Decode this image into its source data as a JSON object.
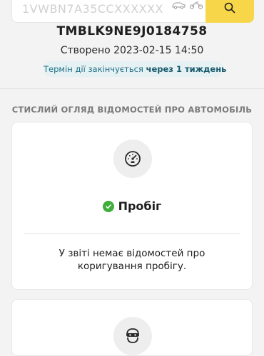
{
  "search": {
    "value": "1VWBN7A35CCXXXXXX",
    "icons": [
      "car-icon",
      "motorcycle-icon"
    ],
    "button_icon": "search-icon"
  },
  "report": {
    "vin": "TMBLK9NE9J0184758",
    "created": "Створено 2023-02-15 14:50",
    "expiry_prefix": "Термін дії закінчується",
    "expiry_value": "через 1 тиждень"
  },
  "overview": {
    "title": "СТИСЛИЙ ОГЛЯД ВІДОМОСТЕЙ ПРО АВТОМОБІЛЬ"
  },
  "cards": [
    {
      "icon": "speedometer-icon",
      "status_icon": "check-circle-icon",
      "heading": "Пробіг",
      "text": "У звіті немає відомостей про коригування пробігу."
    },
    {
      "icon": "thief-icon"
    }
  ],
  "colors": {
    "accent": "#f7d64a",
    "success": "#3fae3a",
    "badge_bg": "#e6f1f3",
    "badge_text": "#1f6f86"
  }
}
